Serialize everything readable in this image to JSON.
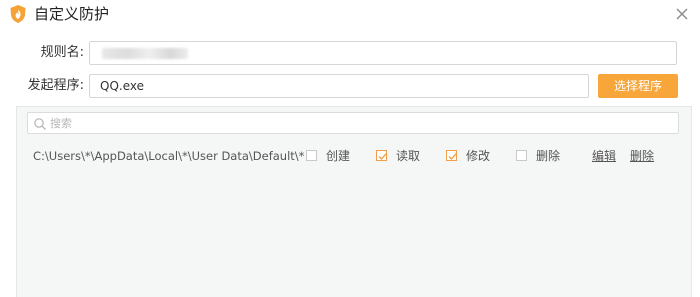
{
  "window": {
    "title": "自定义防护",
    "logo_icon": "shield-flame-icon",
    "close_icon": "close-icon"
  },
  "form": {
    "rule_name_label": "规则名:",
    "rule_name_value": "",
    "program_label": "发起程序:",
    "program_value": "QQ.exe",
    "select_program_button": "选择程序"
  },
  "search": {
    "placeholder": "搜索",
    "icon": "search-icon"
  },
  "rules": [
    {
      "path": "C:\\Users\\*\\AppData\\Local\\*\\User Data\\Default\\*",
      "permissions": [
        {
          "label": "创建",
          "checked": false
        },
        {
          "label": "读取",
          "checked": true
        },
        {
          "label": "修改",
          "checked": true
        },
        {
          "label": "删除",
          "checked": false
        }
      ],
      "actions": {
        "edit": "编辑",
        "delete": "删除"
      }
    }
  ],
  "colors": {
    "accent": "#f8a53a",
    "check": "#f0a04b",
    "panel_bg": "#f5f6f6"
  }
}
